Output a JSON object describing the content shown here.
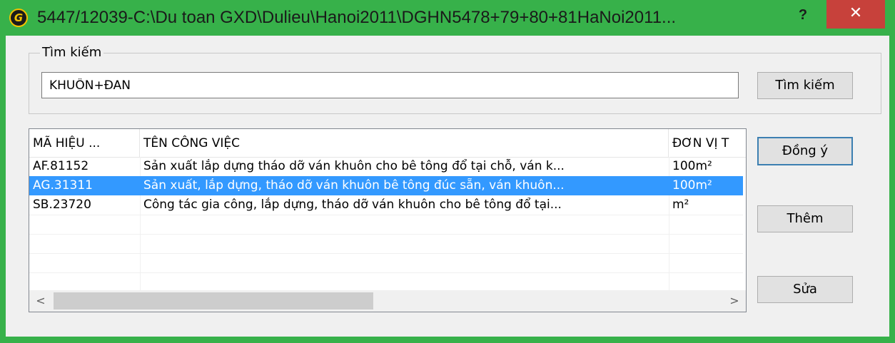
{
  "window": {
    "title": "5447/12039-C:\\Du toan GXD\\Dulieu\\Hanoi2011\\DGHN5478+79+80+81HaNoi2011...",
    "help_label": "?",
    "close_label": "✕",
    "app_icon_glyph": "G"
  },
  "search": {
    "group_label": "Tìm kiếm",
    "query": "KHUÔN+ĐAN",
    "button_label": "Tìm kiếm"
  },
  "list": {
    "columns": [
      "MÃ HIỆU ...",
      "TÊN CÔNG VIỆC",
      "ĐƠN VỊ T"
    ],
    "rows": [
      {
        "code": "AF.81152",
        "name": "Sản xuất lắp dựng tháo dỡ ván khuôn cho bê tông đổ tại chỗ, ván k...",
        "unit": "100m²",
        "selected": false
      },
      {
        "code": "AG.31311",
        "name": "Sản xuất, lắp dựng, tháo dỡ ván khuôn bê tông đúc sẵn, ván khuôn...",
        "unit": "100m²",
        "selected": true
      },
      {
        "code": "SB.23720",
        "name": "Công tác gia công, lắp dựng, tháo dỡ ván khuôn cho bê tông đổ tại...",
        "unit": "m²",
        "selected": false
      }
    ],
    "scroll_left": "<",
    "scroll_right": ">"
  },
  "buttons": {
    "ok": "Đồng ý",
    "add": "Thêm",
    "edit": "Sửa"
  },
  "colors": {
    "title_bar": "#37b14a",
    "close_button": "#c7413b",
    "selection": "#3399ff"
  }
}
